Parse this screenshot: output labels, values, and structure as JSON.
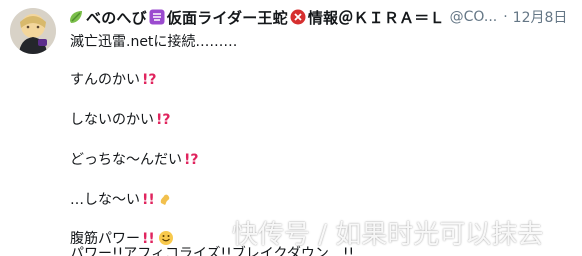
{
  "tweet": {
    "display_name_parts": [
      "べのへび",
      "仮面ライダー王蛇",
      "情報＠ＫＩＲＡ＝Ｌ"
    ],
    "handle": "@CO...",
    "dot": "·",
    "date": "12月8日",
    "lines": [
      "滅亡迅雷.netに接続………",
      "すんのかい",
      "しないのかい",
      "どっちな〜んだい",
      "…しな〜い",
      "腹筋パワー",
      "パワー!!アフィコライズ!!ブレイクダウン…!!"
    ],
    "watermark": "快传号 / 如果时光可以抹去"
  }
}
